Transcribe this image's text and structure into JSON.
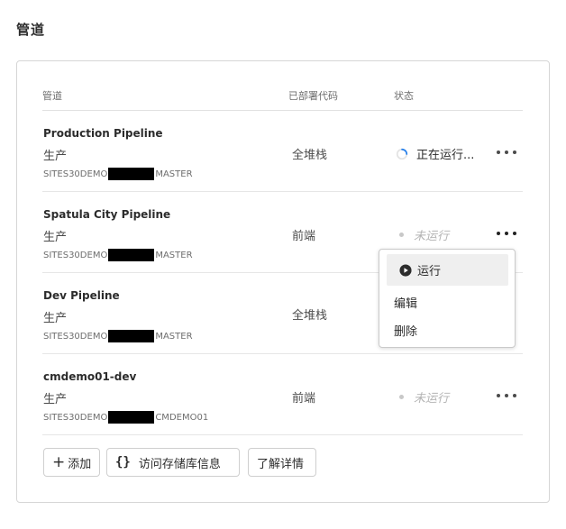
{
  "page": {
    "title": "管道"
  },
  "table": {
    "headers": {
      "pipeline": "管道",
      "deployed_code": "已部署代码",
      "status": "状态"
    },
    "rows": [
      {
        "name": "Production Pipeline",
        "env": "生产",
        "repo_prefix": "SITES30DEMO",
        "repo_suffix": "MASTER",
        "code": "全堆栈",
        "status": "正在运行...",
        "status_state": "running"
      },
      {
        "name": "Spatula City Pipeline",
        "env": "生产",
        "repo_prefix": "SITES30DEMO",
        "repo_suffix": "MASTER",
        "code": "前端",
        "status": "未运行",
        "status_state": "idle"
      },
      {
        "name": "Dev Pipeline",
        "env": "生产",
        "repo_prefix": "SITES30DEMO",
        "repo_suffix": "MASTER",
        "code": "全堆栈",
        "status": "",
        "status_state": "hidden"
      },
      {
        "name": "cmdemo01-dev",
        "env": "生产",
        "repo_prefix": "SITES30DEMO",
        "repo_suffix": "CMDEMO01",
        "code": "前端",
        "status": "未运行",
        "status_state": "idle"
      }
    ]
  },
  "menu": {
    "run": "运行",
    "edit": "编辑",
    "delete": "删除"
  },
  "actions": {
    "add": "添加",
    "repo_info": "访问存储库信息",
    "learn_more": "了解详情"
  },
  "colors": {
    "accent": "#2680eb",
    "border": "#d6d6d6",
    "menu_highlight": "#efefef"
  },
  "icons": {
    "spinner": "spinner-icon",
    "play": "play-circle-icon",
    "more": "more-icon",
    "plus": "plus-icon",
    "braces": "braces-icon"
  }
}
